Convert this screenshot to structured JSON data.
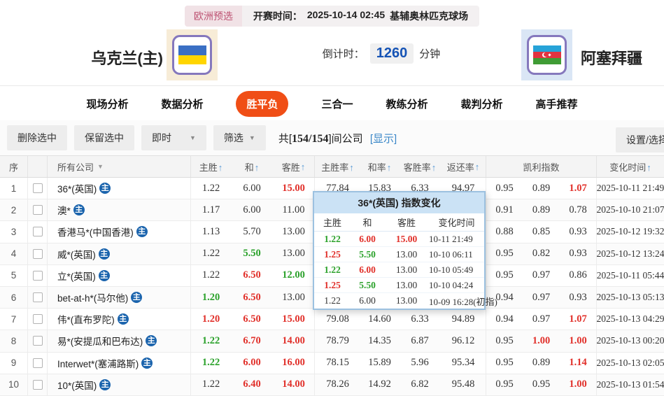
{
  "colors": {
    "accent_red": "#e1302a",
    "accent_green": "#2aa12a",
    "link_blue": "#3a87c8",
    "tab_active_bg": "#f04e16",
    "countdown_blue": "#1553b5",
    "sort_arrow_blue": "#5b9bd5"
  },
  "header": {
    "league_badge": "欧洲预选",
    "start_label": "开赛时间：",
    "start_time": "2025-10-14 02:45",
    "venue": "基辅奥林匹克球场",
    "home_team": "乌克兰(主)",
    "away_team": "阿塞拜疆",
    "countdown_label": "倒计时：",
    "countdown_value": "1260",
    "countdown_unit": "分钟"
  },
  "tabs": [
    {
      "label": "现场分析",
      "active": false
    },
    {
      "label": "数据分析",
      "active": false
    },
    {
      "label": "胜平负",
      "active": true
    },
    {
      "label": "三合一",
      "active": false
    },
    {
      "label": "教练分析",
      "active": false
    },
    {
      "label": "裁判分析",
      "active": false
    },
    {
      "label": "高手推荐",
      "active": false
    }
  ],
  "toolbar": {
    "delete_btn": "删除选中",
    "keep_btn": "保留选中",
    "mode_select": "即时",
    "filter_select": "筛选",
    "count_prefix": "共[",
    "count_value": "154/154",
    "count_suffix": "]间公司",
    "show_link": "[显示]",
    "settings_btn": "设置/选择"
  },
  "table": {
    "host_icon": "主",
    "headers": {
      "index": "序",
      "company": "所有公司",
      "home": "主胜",
      "draw": "和",
      "away": "客胜",
      "home_rate": "主胜率",
      "draw_rate": "和率",
      "away_rate": "客胜率",
      "payout": "返还率",
      "kelly": "凯利指数",
      "time": "变化时间"
    },
    "rows": [
      {
        "index": "1",
        "company": "36*(英国)",
        "odds": [
          {
            "v": "1.22",
            "c": ""
          },
          {
            "v": "6.00",
            "c": ""
          },
          {
            "v": "15.00",
            "c": "up"
          }
        ],
        "pct": [
          "77.84",
          "15.83",
          "6.33",
          "94.97"
        ],
        "kelly": [
          {
            "v": "0.95",
            "c": ""
          },
          {
            "v": "0.89",
            "c": ""
          },
          {
            "v": "1.07",
            "c": "up"
          }
        ],
        "time": "2025-10-11 21:49"
      },
      {
        "index": "2",
        "company": "澳*",
        "odds": [
          {
            "v": "1.17",
            "c": ""
          },
          {
            "v": "6.00",
            "c": ""
          },
          {
            "v": "11.00",
            "c": ""
          }
        ],
        "pct": [
          "",
          "",
          "",
          ""
        ],
        "kelly": [
          {
            "v": "0.91",
            "c": ""
          },
          {
            "v": "0.89",
            "c": ""
          },
          {
            "v": "0.78",
            "c": ""
          }
        ],
        "time": "2025-10-10 21:07"
      },
      {
        "index": "3",
        "company": "香港马*(中国香港)",
        "odds": [
          {
            "v": "1.13",
            "c": ""
          },
          {
            "v": "5.70",
            "c": ""
          },
          {
            "v": "13.00",
            "c": ""
          }
        ],
        "pct": [
          "",
          "",
          "",
          ""
        ],
        "kelly": [
          {
            "v": "0.88",
            "c": ""
          },
          {
            "v": "0.85",
            "c": ""
          },
          {
            "v": "0.93",
            "c": ""
          }
        ],
        "time": "2025-10-12 19:32"
      },
      {
        "index": "4",
        "company": "威*(英国)",
        "odds": [
          {
            "v": "1.22",
            "c": ""
          },
          {
            "v": "5.50",
            "c": "down"
          },
          {
            "v": "13.00",
            "c": ""
          }
        ],
        "pct": [
          "",
          "",
          "",
          ""
        ],
        "kelly": [
          {
            "v": "0.95",
            "c": ""
          },
          {
            "v": "0.82",
            "c": ""
          },
          {
            "v": "0.93",
            "c": ""
          }
        ],
        "time": "2025-10-12 13:24"
      },
      {
        "index": "5",
        "company": "立*(英国)",
        "odds": [
          {
            "v": "1.22",
            "c": ""
          },
          {
            "v": "6.50",
            "c": "up"
          },
          {
            "v": "12.00",
            "c": "down"
          }
        ],
        "pct": [
          "",
          "",
          "",
          ""
        ],
        "kelly": [
          {
            "v": "0.95",
            "c": ""
          },
          {
            "v": "0.97",
            "c": ""
          },
          {
            "v": "0.86",
            "c": ""
          }
        ],
        "time": "2025-10-11 05:44"
      },
      {
        "index": "6",
        "company": "bet-at-h*(马尔他)",
        "odds": [
          {
            "v": "1.20",
            "c": "down"
          },
          {
            "v": "6.50",
            "c": "up"
          },
          {
            "v": "13.00",
            "c": ""
          }
        ],
        "pct": [
          "",
          "",
          "",
          ""
        ],
        "kelly": [
          {
            "v": "0.94",
            "c": ""
          },
          {
            "v": "0.97",
            "c": ""
          },
          {
            "v": "0.93",
            "c": ""
          }
        ],
        "time": "2025-10-13 05:13"
      },
      {
        "index": "7",
        "company": "伟*(直布罗陀)",
        "odds": [
          {
            "v": "1.20",
            "c": "up"
          },
          {
            "v": "6.50",
            "c": "up"
          },
          {
            "v": "15.00",
            "c": "up"
          }
        ],
        "pct": [
          "79.08",
          "14.60",
          "6.33",
          "94.89"
        ],
        "kelly": [
          {
            "v": "0.94",
            "c": ""
          },
          {
            "v": "0.97",
            "c": ""
          },
          {
            "v": "1.07",
            "c": "up"
          }
        ],
        "time": "2025-10-13 04:29"
      },
      {
        "index": "8",
        "company": "易*(安提瓜和巴布达)",
        "odds": [
          {
            "v": "1.22",
            "c": "down"
          },
          {
            "v": "6.70",
            "c": "up"
          },
          {
            "v": "14.00",
            "c": "up"
          }
        ],
        "pct": [
          "78.79",
          "14.35",
          "6.87",
          "96.12"
        ],
        "kelly": [
          {
            "v": "0.95",
            "c": ""
          },
          {
            "v": "1.00",
            "c": "up"
          },
          {
            "v": "1.00",
            "c": "up"
          }
        ],
        "time": "2025-10-13 00:20"
      },
      {
        "index": "9",
        "company": "Interwet*(塞浦路斯)",
        "odds": [
          {
            "v": "1.22",
            "c": "down"
          },
          {
            "v": "6.00",
            "c": "up"
          },
          {
            "v": "16.00",
            "c": "up"
          }
        ],
        "pct": [
          "78.15",
          "15.89",
          "5.96",
          "95.34"
        ],
        "kelly": [
          {
            "v": "0.95",
            "c": ""
          },
          {
            "v": "0.89",
            "c": ""
          },
          {
            "v": "1.14",
            "c": "up"
          }
        ],
        "time": "2025-10-13 02:05"
      },
      {
        "index": "10",
        "company": "10*(英国)",
        "odds": [
          {
            "v": "1.22",
            "c": ""
          },
          {
            "v": "6.40",
            "c": "up"
          },
          {
            "v": "14.00",
            "c": "up"
          }
        ],
        "pct": [
          "78.26",
          "14.92",
          "6.82",
          "95.48"
        ],
        "kelly": [
          {
            "v": "0.95",
            "c": ""
          },
          {
            "v": "0.95",
            "c": ""
          },
          {
            "v": "1.00",
            "c": "up"
          }
        ],
        "time": "2025-10-13 01:54"
      }
    ]
  },
  "popup": {
    "title": "36*(英国) 指数变化",
    "headers": {
      "home": "主胜",
      "draw": "和",
      "away": "客胜",
      "time": "变化时间"
    },
    "rows": [
      {
        "odds": [
          {
            "v": "1.22",
            "c": "down"
          },
          {
            "v": "6.00",
            "c": "up"
          },
          {
            "v": "15.00",
            "c": "up"
          }
        ],
        "time": "10-11 21:49"
      },
      {
        "odds": [
          {
            "v": "1.25",
            "c": "up"
          },
          {
            "v": "5.50",
            "c": "down"
          },
          {
            "v": "13.00",
            "c": ""
          }
        ],
        "time": "10-10 06:11"
      },
      {
        "odds": [
          {
            "v": "1.22",
            "c": "down"
          },
          {
            "v": "6.00",
            "c": "up"
          },
          {
            "v": "13.00",
            "c": ""
          }
        ],
        "time": "10-10 05:49"
      },
      {
        "odds": [
          {
            "v": "1.25",
            "c": "up"
          },
          {
            "v": "5.50",
            "c": "down"
          },
          {
            "v": "13.00",
            "c": ""
          }
        ],
        "time": "10-10 04:24"
      },
      {
        "odds": [
          {
            "v": "1.22",
            "c": ""
          },
          {
            "v": "6.00",
            "c": ""
          },
          {
            "v": "13.00",
            "c": ""
          }
        ],
        "time": "10-09 16:28(初指)"
      }
    ]
  }
}
